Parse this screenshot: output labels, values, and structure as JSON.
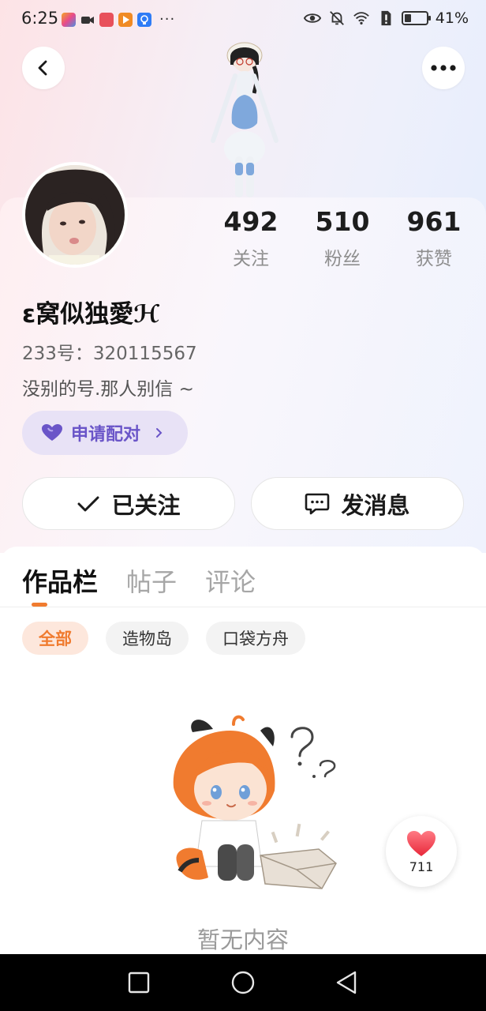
{
  "status_bar": {
    "time": "6:25",
    "battery_percent": "41%",
    "battery_level": 0.41,
    "more_dots": "···"
  },
  "header": {
    "back_icon": "chevron-left-icon",
    "more_icon": "more-horizontal-icon"
  },
  "profile": {
    "nickname": "ε窝似独愛ℋ",
    "uid": "233号：320115567",
    "bio": "没别的号.那人别信 ~",
    "stats": [
      {
        "value": "492",
        "label": "关注"
      },
      {
        "value": "510",
        "label": "粉丝"
      },
      {
        "value": "961",
        "label": "获赞"
      }
    ],
    "pair_button": {
      "label": "申请配对",
      "icon": "heart-icon"
    }
  },
  "actions": {
    "follow_label": "已关注",
    "message_label": "发消息"
  },
  "tabs": [
    {
      "label": "作品栏",
      "active": true
    },
    {
      "label": "帖子",
      "active": false
    },
    {
      "label": "评论",
      "active": false
    }
  ],
  "filters": [
    {
      "label": "全部",
      "active": true
    },
    {
      "label": "造物岛",
      "active": false
    },
    {
      "label": "口袋方舟",
      "active": false
    }
  ],
  "empty_state": {
    "text": "暂无内容"
  },
  "like_float": {
    "count": "711"
  },
  "colors": {
    "accent_orange": "#f07b2f",
    "pair_purple": "#6a55c8",
    "heart_red": "#f23a4a"
  }
}
